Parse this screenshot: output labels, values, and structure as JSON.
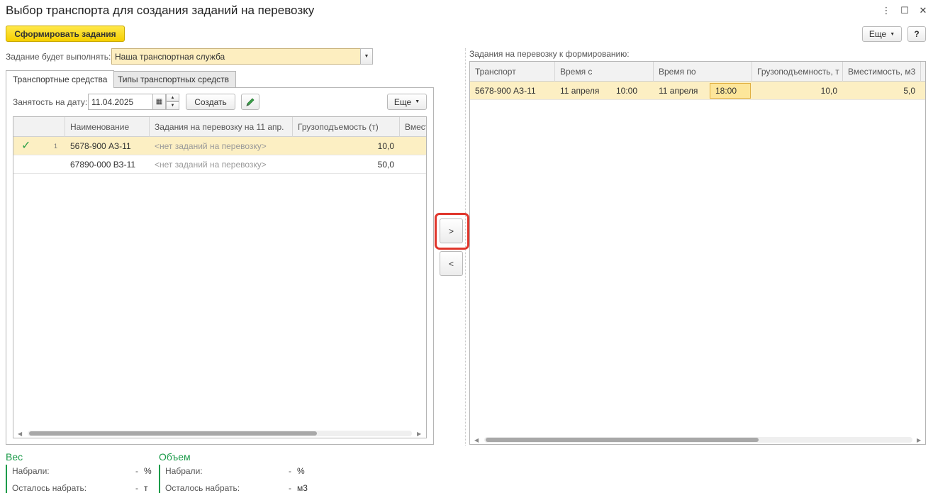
{
  "window": {
    "title": "Выбор транспорта для создания заданий на перевозку",
    "menu_icon": "⋮",
    "maximize_icon": "☐",
    "close_icon": "✕"
  },
  "toolbar": {
    "form_tasks_label": "Сформировать задания",
    "more_label": "Еще",
    "help_label": "?"
  },
  "executor": {
    "label": "Задание будет выполнять:",
    "value": "Наша транспортная служба"
  },
  "tabs": [
    {
      "label": "Транспортные средства",
      "active": true
    },
    {
      "label": "Типы транспортных средств",
      "active": false
    }
  ],
  "left": {
    "date_label": "Занятость на дату:",
    "date_value": "11.04.2025",
    "create_label": "Создать",
    "more_label": "Еще",
    "columns": [
      "Наименование",
      "Задания на перевозку на 11 апр.",
      "Грузоподъемость (т)",
      "Вмест"
    ],
    "rows": [
      {
        "check": "✓",
        "num": "1",
        "name": "5678-900 АЗ-11",
        "tasks": "<нет заданий на перевозку>",
        "capacity": "10,0",
        "selected": true
      },
      {
        "check": "",
        "num": "",
        "name": "67890-000 ВЗ-11",
        "tasks": "<нет заданий на перевозку>",
        "capacity": "50,0",
        "selected": false
      }
    ]
  },
  "middle": {
    "move_right": ">",
    "move_left": "<",
    "highlight_color": "#e0362c"
  },
  "right": {
    "caption": "Задания на перевозку к формированию:",
    "columns": [
      "Транспорт",
      "Время с",
      "Время по",
      "Грузоподъемность, т",
      "Вместимость, м3"
    ],
    "rows": [
      {
        "transport": "5678-900 АЗ-11",
        "from_date": "11 апреля",
        "from_time": "10:00",
        "to_date": "11 апреля",
        "to_time": "18:00",
        "capacity": "10,0",
        "volume": "5,0"
      }
    ]
  },
  "summary": {
    "weight": {
      "title": "Вес",
      "taken_label": "Набрали:",
      "taken_value": "-",
      "taken_unit": "%",
      "left_label": "Осталось набрать:",
      "left_value": "-",
      "left_unit": "т"
    },
    "volume": {
      "title": "Объем",
      "taken_label": "Набрали:",
      "taken_value": "-",
      "taken_unit": "%",
      "left_label": "Осталось набрать:",
      "left_value": "-",
      "left_unit": "м3"
    }
  },
  "colors": {
    "accent_yellow": "#f6cf00",
    "selected_row": "#fcefc3",
    "green": "#1c9b4a"
  }
}
